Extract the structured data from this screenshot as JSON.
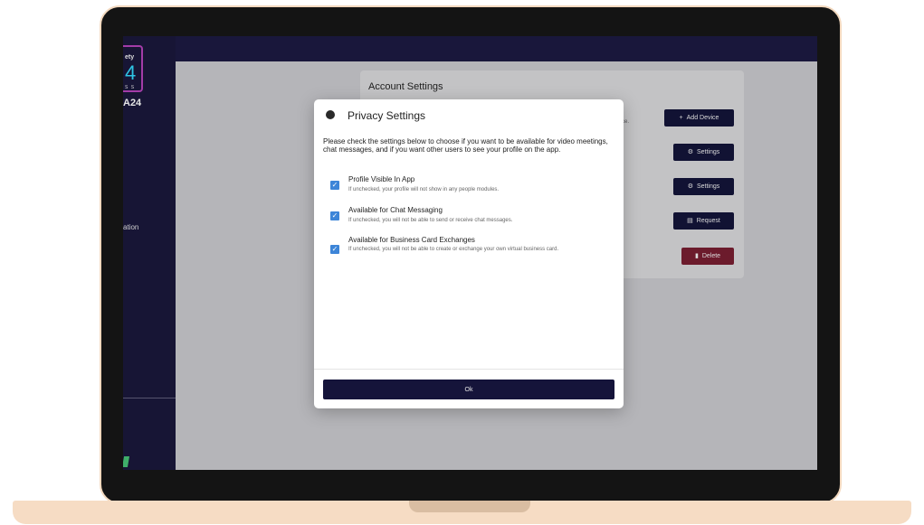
{
  "sidebar": {
    "logo_top": "ety",
    "logo_num": "4",
    "logo_sub": "S S",
    "title": "A24",
    "nav_item": "ation"
  },
  "account": {
    "title": "Account Settings",
    "desc_fragment": "ce.",
    "buttons": {
      "add_device": "Add Device",
      "settings_1": "Settings",
      "settings_2": "Settings",
      "request": "Request",
      "delete": "Delete"
    },
    "icons": {
      "add_device": "plus-icon",
      "settings_1": "settings-icon",
      "settings_2": "settings-icon",
      "request": "document-icon",
      "delete": "trash-icon"
    }
  },
  "dialog": {
    "title": "Privacy Settings",
    "icon": "privacy-icon",
    "intro": "Please check the settings below to choose if you want to be available for video meetings, chat messages, and if you want other users to see your profile on the app.",
    "options": [
      {
        "label": "Profile Visible In App",
        "help": "If unchecked, your profile will not show in any people modules.",
        "checked": true
      },
      {
        "label": "Available for Chat Messaging",
        "help": "If unchecked, you will not be able to send or receive chat messages.",
        "checked": true
      },
      {
        "label": "Available for Business Card Exchanges",
        "help": "If unchecked, you will not be able to create or exchange your own virtual business card.",
        "checked": true
      }
    ],
    "ok_label": "Ok"
  },
  "colors": {
    "sidebar": "#171535",
    "overlay": "#b5b5b9",
    "button_dark": "#111233",
    "button_danger": "#6c1b2c",
    "checkbox": "#3d85d8",
    "laptop_frame": "#f6dcc4"
  }
}
